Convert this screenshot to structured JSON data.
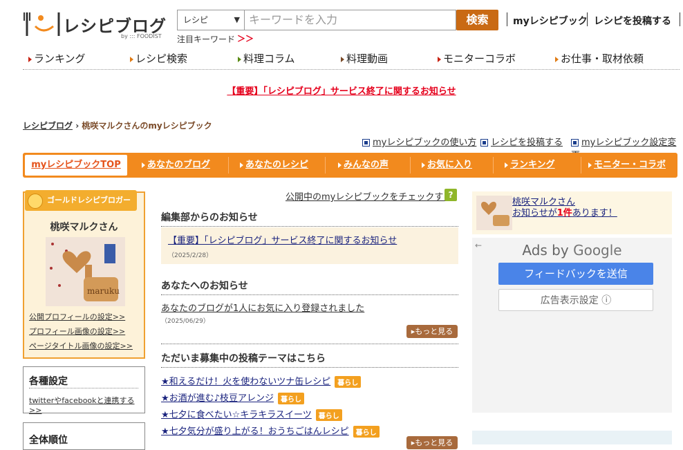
{
  "header": {
    "logo": "レシピブログ",
    "logo_sub": "by ::: FOODIST",
    "search_category": "レシピ",
    "search_placeholder": "キーワードを入力",
    "search_button": "検索",
    "links": [
      "myレシピブック",
      "レシピを投稿する"
    ],
    "trending_label": "注目キーワード",
    "trending_more": "＞＞"
  },
  "global_nav": [
    "ランキング",
    "レシピ検索",
    "料理コラム",
    "料理動画",
    "モニターコラボ",
    "お仕事・取材依頼"
  ],
  "notice": "【重要】「レシピブログ」サービス終了に関するお知らせ",
  "breadcrumb": {
    "home": "レシピブログ",
    "sep": "›",
    "current": "桃咲マルクさんのmyレシピブック"
  },
  "util_links": [
    "myレシピブックの使い方",
    "レシピを投稿する",
    "myレシピブック設定変更"
  ],
  "tabs": [
    "myレシピブックTOP",
    "あなたのブログ",
    "あなたのレシピ",
    "みんなの声",
    "お気に入り",
    "ランキング",
    "モニター・コラボ"
  ],
  "profile": {
    "badge": "ゴールドレシピブロガー",
    "name": "桃咲マルクさん",
    "image_text": "maruku",
    "links": [
      "公開プロフィールの設定>>",
      "プロフィール画像の設定>>",
      "ページタイトル画像の設定>>"
    ]
  },
  "settings": {
    "title": "各種設定",
    "link": "twitterやfacebookと連携する>>"
  },
  "ranking_box": {
    "title": "全体順位"
  },
  "main": {
    "check_link": "公開中のmyレシピブックをチェックする",
    "help": "?",
    "editorial": {
      "title": "編集部からのお知らせ",
      "item": "【重要】「レシピブログ」サービス終了に関するお知らせ",
      "date": "（2025/2/28）"
    },
    "your_notice": {
      "title": "あなたへのお知らせ",
      "item": "あなたのブログが1人にお気に入り登録されました",
      "date": "（2025/06/29）",
      "more": "▸もっと見る"
    },
    "themes": {
      "title": "ただいま募集中の投稿テーマはこちら",
      "items": [
        {
          "text": "★和えるだけ！火を使わないツナ缶レシピ",
          "tag": "暮らし"
        },
        {
          "text": "★お酒が進む♪枝豆アレンジ",
          "tag": "暮らし"
        },
        {
          "text": "★七夕に食べたい☆キラキラスイーツ",
          "tag": "暮らし"
        },
        {
          "text": "★七夕気分が盛り上がる！おうちごはんレシピ",
          "tag": "暮らし"
        }
      ],
      "more": "▸もっと見る"
    }
  },
  "right": {
    "notify_name": "桃咲マルクさん",
    "notify_pre": "お知らせが",
    "notify_count": "1件",
    "notify_post": "あります！",
    "ads_by": "Ads by",
    "ads_brand": "Google",
    "feedback": "フィードバックを送信",
    "ad_settings": "広告表示設定 ⓘ",
    "back": "←"
  },
  "colors": {
    "accent": "#f28a1e",
    "search_button": "#c96a14",
    "notice": "#e5001c"
  }
}
